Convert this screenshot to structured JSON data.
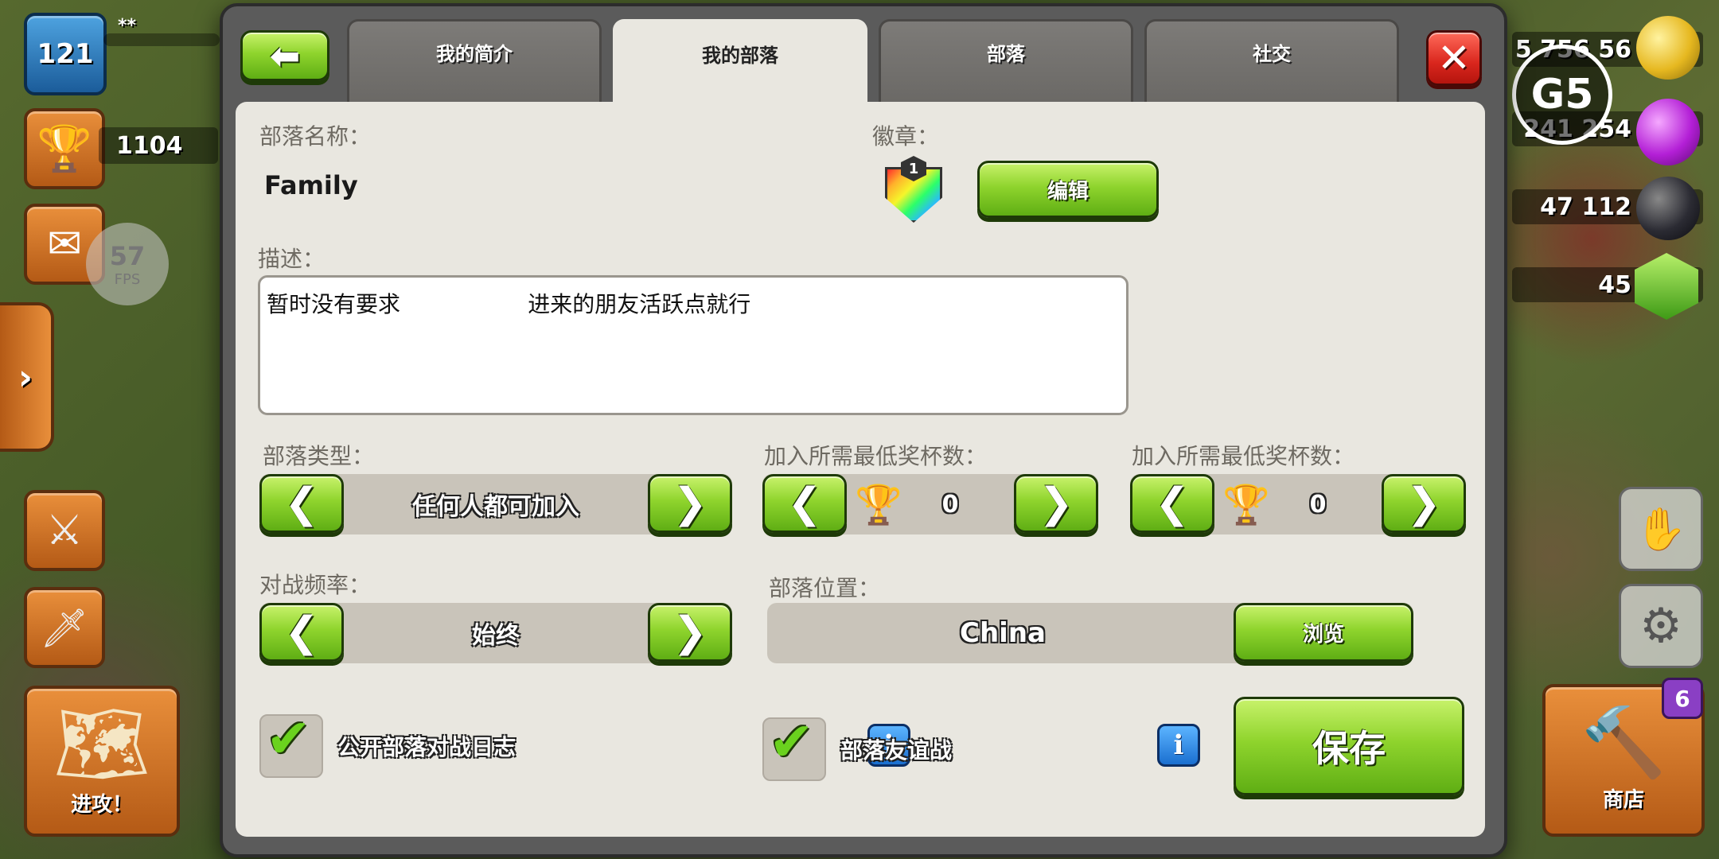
{
  "hud": {
    "level": "121",
    "player_name": "**",
    "trophies": "1104",
    "fps_value": "57",
    "fps_label": "FPS",
    "attack_label": "进攻！",
    "shop_label": "商店",
    "shop_badge": "6",
    "gold": "5 756 56",
    "elixir": "241 254",
    "dark_elixir": "47 112",
    "gems": "45",
    "brand_logo": "G5"
  },
  "tabs": [
    {
      "label": "我的简介"
    },
    {
      "label": "我的部落"
    },
    {
      "label": "部落"
    },
    {
      "label": "社交"
    }
  ],
  "form": {
    "clan_name_label": "部落名称：",
    "clan_name": "Family",
    "badge_label": "徽章：",
    "badge_level": "1",
    "edit_button": "编辑",
    "description_label": "描述：",
    "description": "暂时没有要求                  进来的朋友活跃点就行",
    "clan_type_label": "部落类型：",
    "clan_type_value": "任何人都可加入",
    "min_trophies_label": "加入所需最低奖杯数：",
    "min_trophies_value": "0",
    "min_trophies_label_2": "加入所需最低奖杯数：",
    "min_trophies_value_2": "0",
    "war_frequency_label": "对战频率：",
    "war_frequency_value": "始终",
    "location_label": "部落位置：",
    "location_value": "China",
    "browse_button": "浏览",
    "public_war_log_label": "公开部落对战日志",
    "friendly_war_label": "部落友谊战",
    "save_button": "保存"
  }
}
